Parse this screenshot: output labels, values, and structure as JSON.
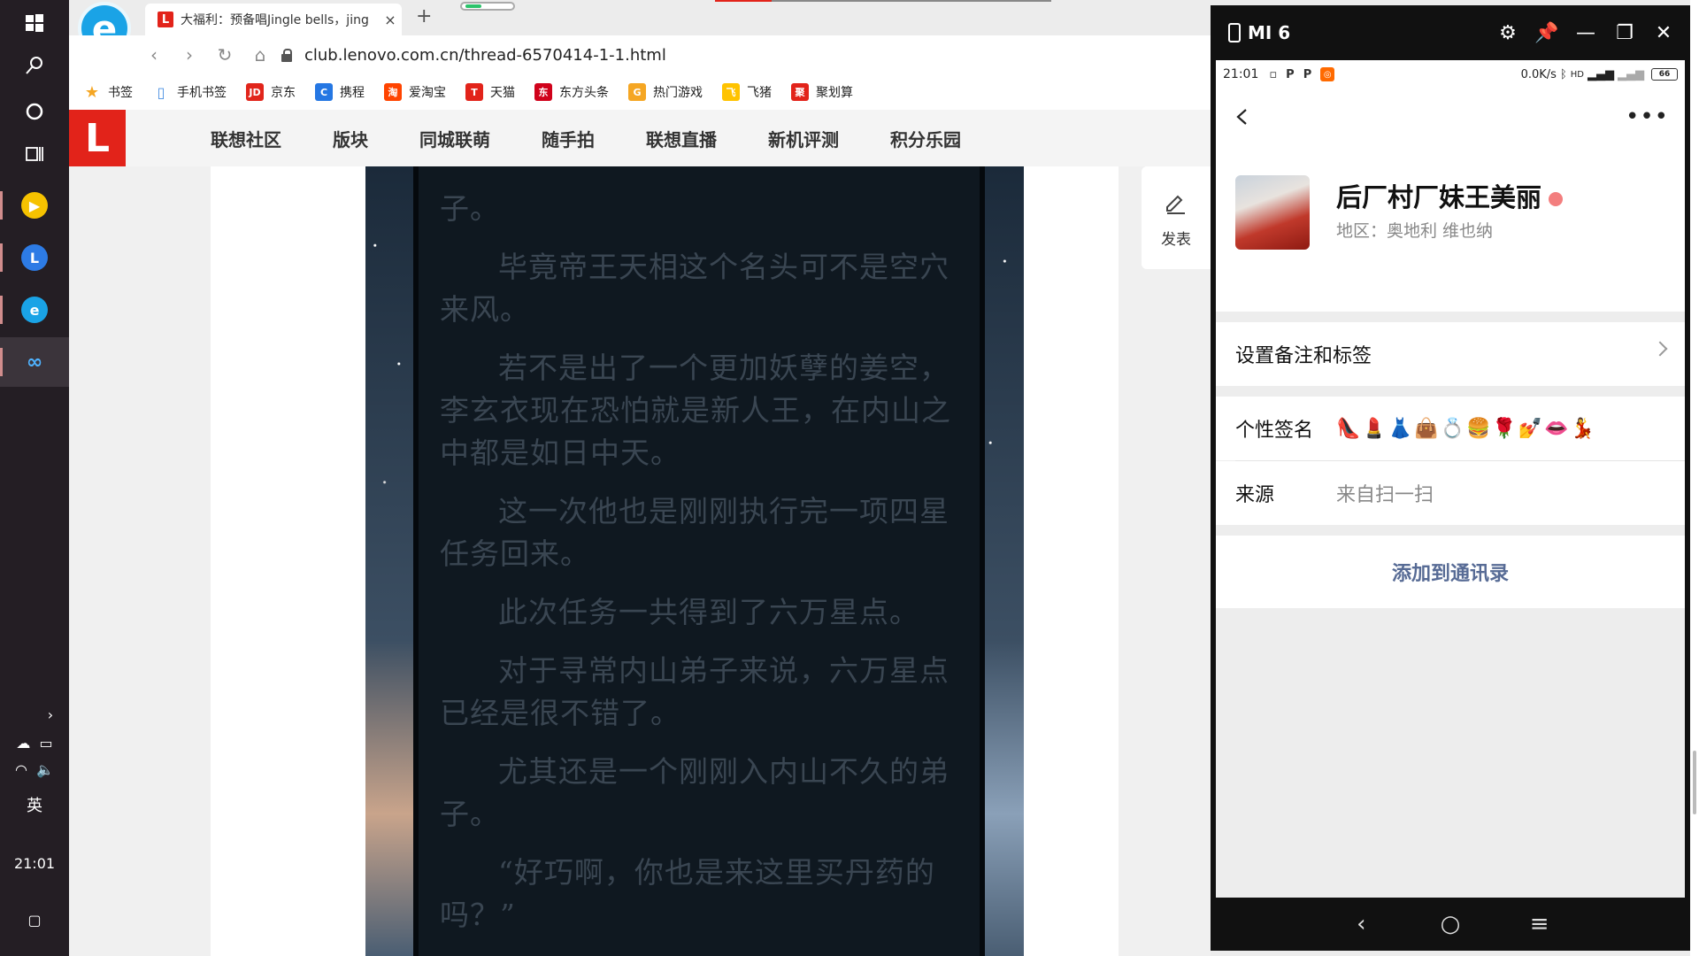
{
  "taskbar": {
    "lang": "英",
    "time": "21:01"
  },
  "browser": {
    "tab_title": "大福利：预备唱Jingle bells，jing",
    "tab_close": "×",
    "newtab": "+",
    "url": "club.lenovo.com.cn/thread-6570414-1-1.html",
    "bookmarks": [
      {
        "label": "书签",
        "icon": "star-icon",
        "color": "#f5a623"
      },
      {
        "label": "手机书签",
        "icon": "phone-bookmark-icon",
        "color": "#4a90e2"
      },
      {
        "label": "京东",
        "icon": "jd-icon",
        "color": "#e1251b",
        "glyph": "JD"
      },
      {
        "label": "携程",
        "icon": "ctrip-icon",
        "color": "#2577e3",
        "glyph": "C"
      },
      {
        "label": "爱淘宝",
        "icon": "taobao-icon",
        "color": "#ff4400",
        "glyph": "淘"
      },
      {
        "label": "天猫",
        "icon": "tmall-icon",
        "color": "#e2231a",
        "glyph": "T"
      },
      {
        "label": "东方头条",
        "icon": "dftt-icon",
        "color": "#d0021b",
        "glyph": "东"
      },
      {
        "label": "热门游戏",
        "icon": "game-icon",
        "color": "#f5a623",
        "glyph": "G"
      },
      {
        "label": "飞猪",
        "icon": "fliggy-icon",
        "color": "#ffc300",
        "glyph": "飞"
      },
      {
        "label": "聚划算",
        "icon": "juhuasuan-icon",
        "color": "#e2231a",
        "glyph": "聚"
      }
    ]
  },
  "site": {
    "logo": "L",
    "nav": [
      "联想社区",
      "版块",
      "同城联萌",
      "随手拍",
      "联想直播",
      "新机评测",
      "积分乐园"
    ],
    "post_label": "发表",
    "paragraphs": [
      {
        "text": "子。",
        "indent": false
      },
      {
        "text": "毕竟帝王天相这个名头可不是空穴来风。",
        "indent": true
      },
      {
        "text": "若不是出了一个更加妖孽的姜空，李玄衣现在恐怕就是新人王，在内山之中都是如日中天。",
        "indent": true
      },
      {
        "text": "这一次他也是刚刚执行完一项四星任务回来。",
        "indent": true
      },
      {
        "text": "此次任务一共得到了六万星点。",
        "indent": true
      },
      {
        "text": "对于寻常内山弟子来说，六万星点已经是很不错了。",
        "indent": true
      },
      {
        "text": "尤其还是一个刚刚入内山不久的弟子。",
        "indent": true
      },
      {
        "text": "“好巧啊，你也是来这里买丹药的吗？”",
        "indent": true
      }
    ]
  },
  "phone": {
    "window_title": "MI 6",
    "status": {
      "time": "21:01",
      "speed": "0.0K/s",
      "battery": "66"
    },
    "profile": {
      "nickname": "后厂村厂妹王美丽",
      "region": "地区：奥地利  维也纳"
    },
    "rows": {
      "remark": "设置备注和标签",
      "signature_label": "个性签名",
      "signature_value": "👠💄👗👜💍🍔🌹💅👄💃",
      "source_label": "来源",
      "source_value": "来自扫一扫"
    },
    "add_contact": "添加到通讯录",
    "link_color": "#576b95"
  }
}
